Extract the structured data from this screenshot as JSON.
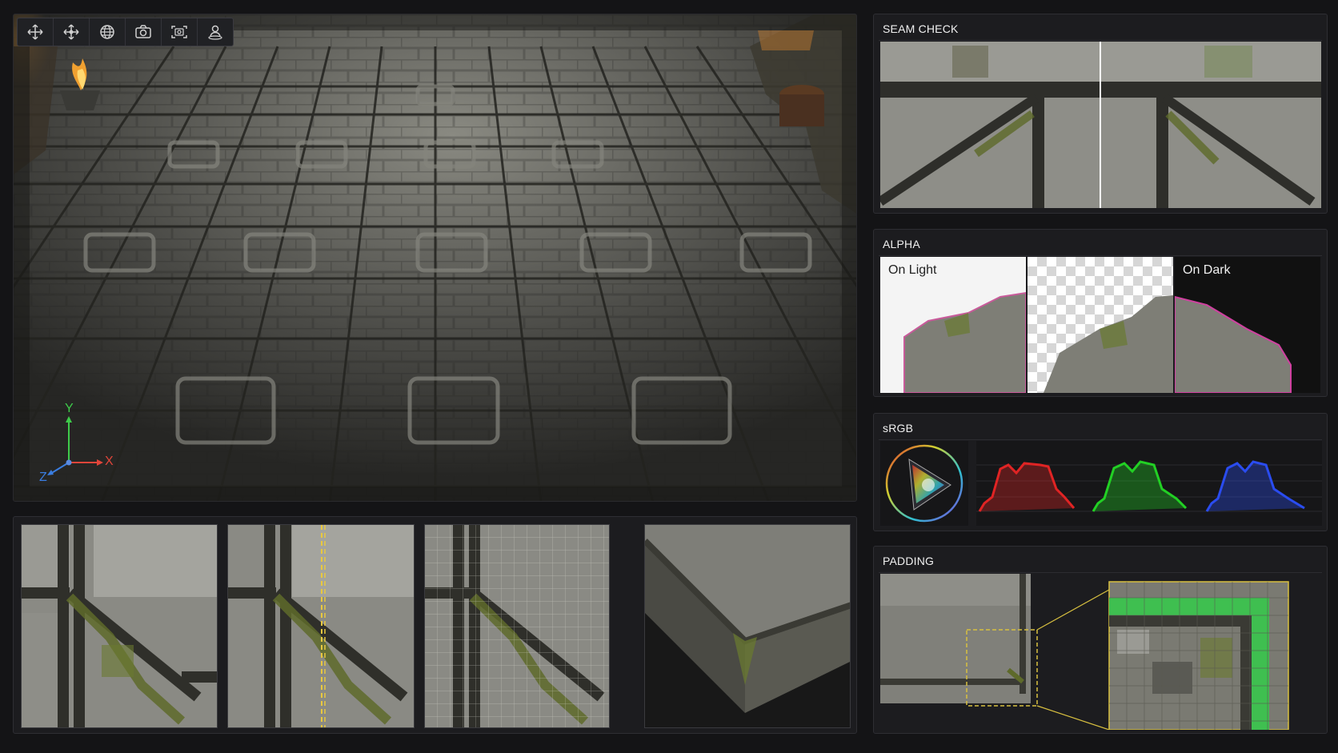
{
  "toolbar": {
    "tools": [
      {
        "name": "move-icon"
      },
      {
        "name": "pan-icon"
      },
      {
        "name": "globe-icon"
      },
      {
        "name": "camera-icon"
      },
      {
        "name": "frame-capture-icon"
      },
      {
        "name": "user-pin-icon"
      }
    ]
  },
  "viewport": {
    "axis": {
      "y": "Y",
      "x": "X",
      "z": "Z"
    },
    "axis_colors": {
      "y": "#3ecb4a",
      "x": "#e0453a",
      "z": "#3a7de0"
    }
  },
  "panels": {
    "seam_check": {
      "title": "SEAM CHECK"
    },
    "alpha": {
      "title": "ALPHA",
      "on_light": "On Light",
      "on_dark": "On Dark"
    },
    "srgb": {
      "title": "sRGB",
      "channel_colors": [
        "#e02424",
        "#22d024",
        "#2a4cf0"
      ]
    },
    "padding": {
      "title": "PADDING",
      "highlight_color": "#d8c040",
      "padding_color": "#3fbf50"
    }
  },
  "colors": {
    "background": "#141416",
    "panel": "#1c1c1f",
    "stone": "#6a6a64",
    "grout": "#2a2a26",
    "moss": "#5e6a2a",
    "seam_guide": "#e8c840"
  }
}
